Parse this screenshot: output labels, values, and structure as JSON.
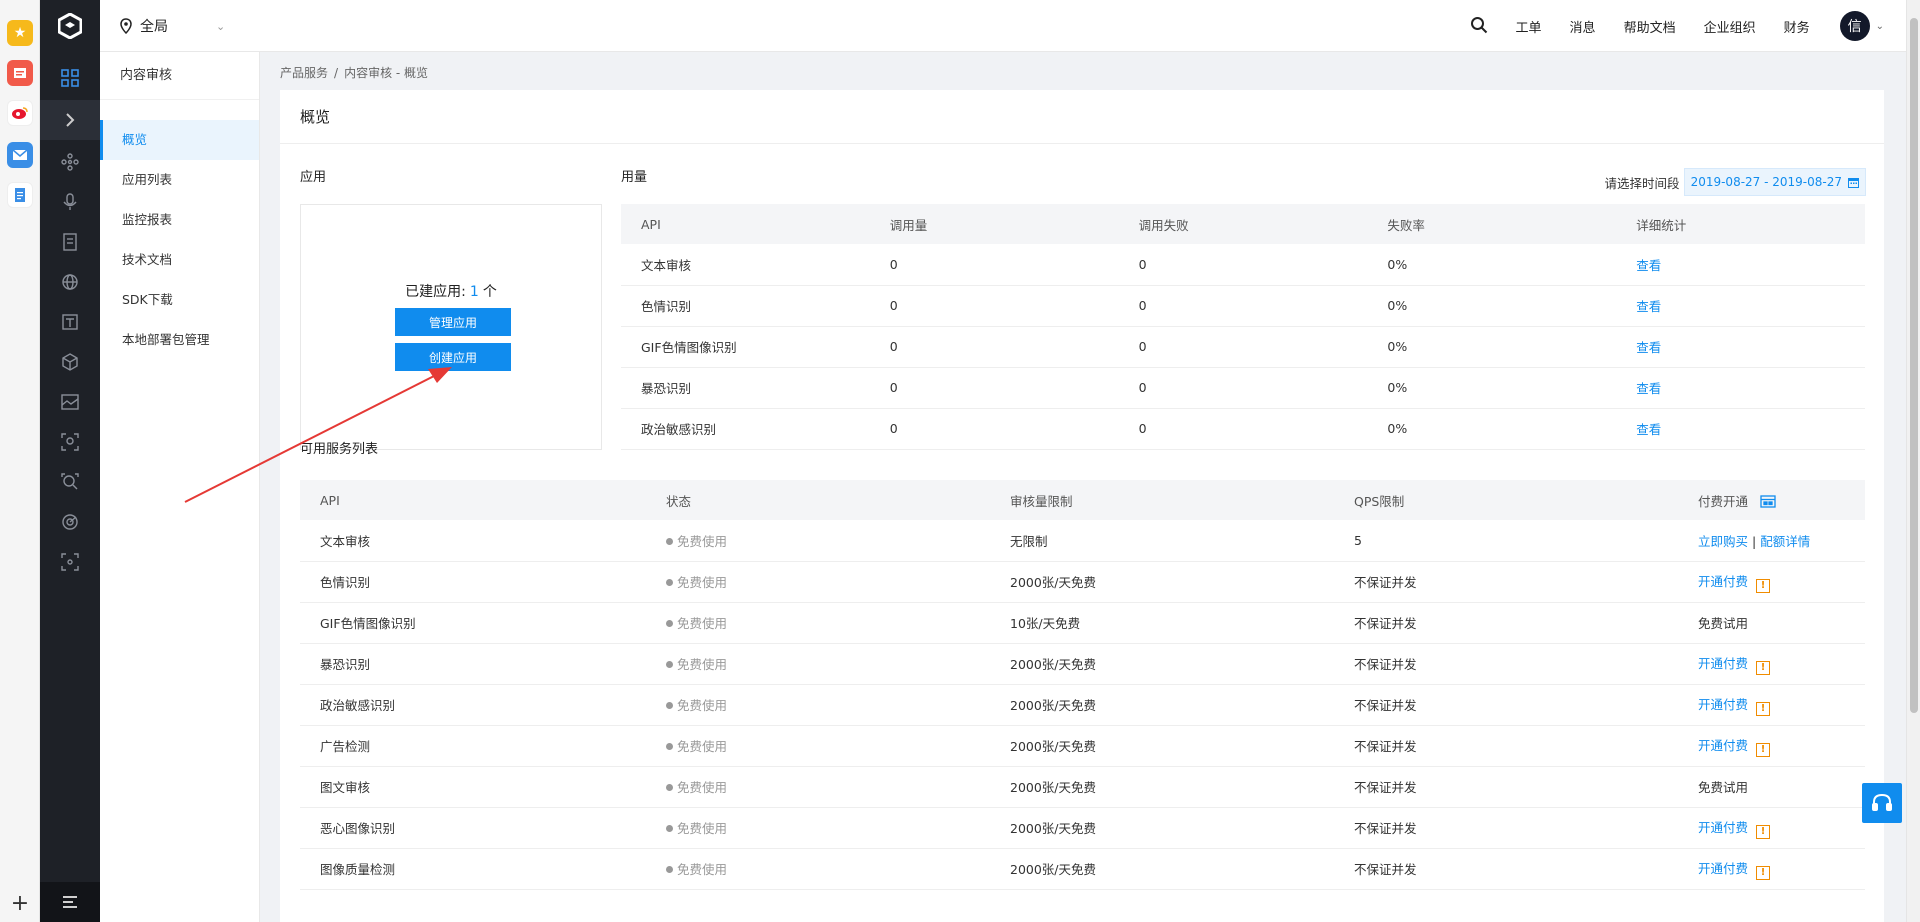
{
  "dock": {
    "apps": [
      {
        "icon": "star-app-icon",
        "color": "#f6b91b"
      },
      {
        "icon": "notes-app-icon",
        "color": "#f15a4a"
      },
      {
        "icon": "weibo-app-icon",
        "color": "#e6162d"
      },
      {
        "icon": "mail-app-icon",
        "color": "#3a8ee6"
      },
      {
        "icon": "docs-app-icon",
        "color": "#3a8ee6"
      }
    ],
    "add_label": "+"
  },
  "header": {
    "region": "全局",
    "nav": [
      "工单",
      "消息",
      "帮助文档",
      "企业组织",
      "财务"
    ],
    "avatar": "信"
  },
  "subnav": {
    "title": "内容审核",
    "items": [
      "概览",
      "应用列表",
      "监控报表",
      "技术文档",
      "SDK下载",
      "本地部署包管理"
    ],
    "active": 0
  },
  "breadcrumb": {
    "parent": "产品服务",
    "sep": "/",
    "current": "内容审核 - 概览"
  },
  "page": {
    "title": "概览",
    "apps_label": "应用",
    "usage_label": "用量",
    "services_label": "可用服务列表"
  },
  "apps": {
    "count_prefix": "已建应用:",
    "count": "1",
    "count_suffix": "个",
    "manage_button": "管理应用",
    "create_button": "创建应用"
  },
  "usage": {
    "range_label": "请选择时间段",
    "range": "2019-08-27 - 2019-08-27",
    "columns": [
      "API",
      "调用量",
      "调用失败",
      "失败率",
      "详细统计"
    ],
    "rows": [
      {
        "api": "文本审核",
        "calls": "0",
        "failed": "0",
        "rate": "0%",
        "detail": "查看"
      },
      {
        "api": "色情识别",
        "calls": "0",
        "failed": "0",
        "rate": "0%",
        "detail": "查看"
      },
      {
        "api": "GIF色情图像识别",
        "calls": "0",
        "failed": "0",
        "rate": "0%",
        "detail": "查看"
      },
      {
        "api": "暴恐识别",
        "calls": "0",
        "failed": "0",
        "rate": "0%",
        "detail": "查看"
      },
      {
        "api": "政治敏感识别",
        "calls": "0",
        "failed": "0",
        "rate": "0%",
        "detail": "查看"
      }
    ]
  },
  "services": {
    "columns": [
      "API",
      "状态",
      "审核量限制",
      "QPS限制",
      "付费开通"
    ],
    "rows": [
      {
        "api": "文本审核",
        "status": "免费使用",
        "limit": "无限制",
        "qps": "5",
        "pay": "立即购买",
        "pay_sep": "|",
        "pay2": "配额详情",
        "warn": false
      },
      {
        "api": "色情识别",
        "status": "免费使用",
        "limit": "2000张/天免费",
        "qps": "不保证并发",
        "pay": "开通付费",
        "warn": true
      },
      {
        "api": "GIF色情图像识别",
        "status": "免费使用",
        "limit": "10张/天免费",
        "qps": "不保证并发",
        "pay_text": "免费试用",
        "warn": false
      },
      {
        "api": "暴恐识别",
        "status": "免费使用",
        "limit": "2000张/天免费",
        "qps": "不保证并发",
        "pay": "开通付费",
        "warn": true
      },
      {
        "api": "政治敏感识别",
        "status": "免费使用",
        "limit": "2000张/天免费",
        "qps": "不保证并发",
        "pay": "开通付费",
        "warn": true
      },
      {
        "api": "广告检测",
        "status": "免费使用",
        "limit": "2000张/天免费",
        "qps": "不保证并发",
        "pay": "开通付费",
        "warn": true
      },
      {
        "api": "图文审核",
        "status": "免费使用",
        "limit": "2000张/天免费",
        "qps": "不保证并发",
        "pay_text": "免费试用",
        "warn": false
      },
      {
        "api": "恶心图像识别",
        "status": "免费使用",
        "limit": "2000张/天免费",
        "qps": "不保证并发",
        "pay": "开通付费",
        "warn": true
      },
      {
        "api": "图像质量检测",
        "status": "免费使用",
        "limit": "2000张/天免费",
        "qps": "不保证并发",
        "pay": "开通付费",
        "warn": true
      }
    ],
    "warn_glyph": "!"
  },
  "colors": {
    "accent": "#108cee",
    "rail": "#1e2127",
    "warn": "#f08c00",
    "annotation_arrow": "#e53935"
  }
}
